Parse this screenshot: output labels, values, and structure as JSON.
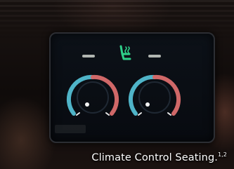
{
  "caption": {
    "text": "Climate Control Seating.",
    "superscript": "1,2"
  },
  "climate_display": {
    "center_icon": "heated-cooled-seat-icon",
    "left_dial_icon": "seat-temperature-dial-icon",
    "right_dial_icon": "seat-temperature-dial-icon",
    "colors": {
      "cool": "#4fb4c8",
      "heat": "#d06868",
      "icon": "#2fd08a"
    }
  }
}
